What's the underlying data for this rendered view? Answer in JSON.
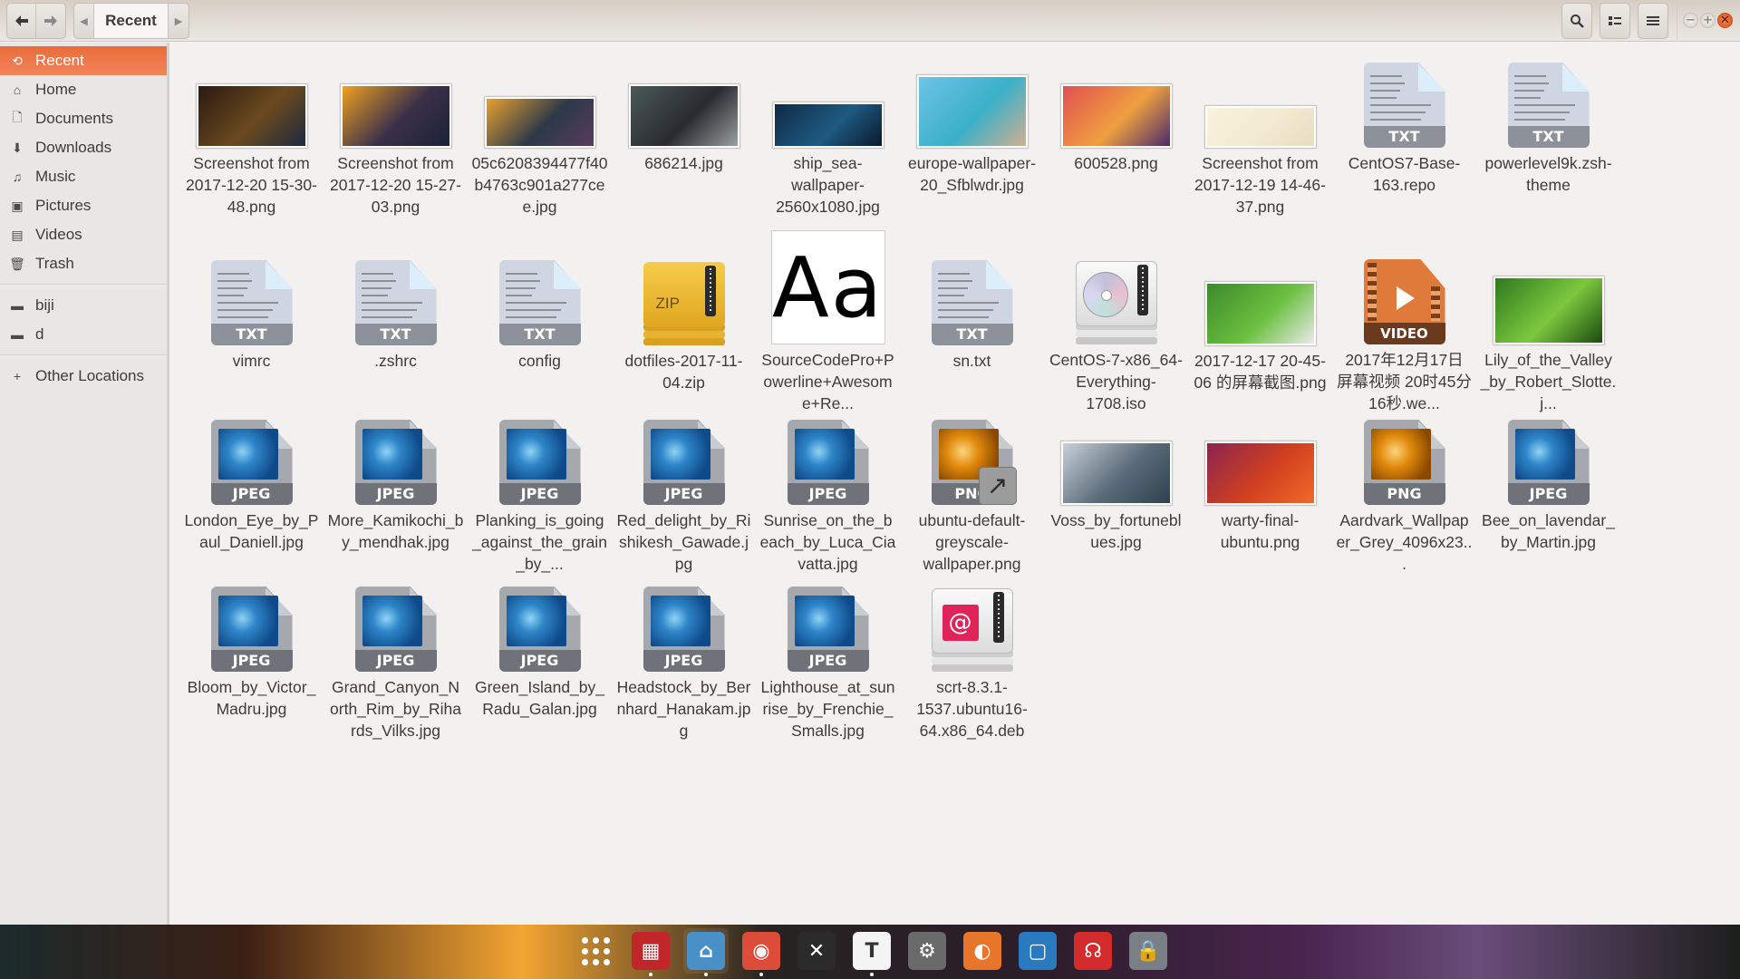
{
  "window": {
    "title": "Recent",
    "nav": {
      "back_icon": "arrow-left-icon",
      "forward_icon": "arrow-right-icon"
    },
    "path": {
      "current": "Recent",
      "left_arrow": "◀",
      "right_arrow": "▶"
    },
    "tools": {
      "search_icon": "search-icon",
      "view_icon": "list-view-icon",
      "menu_icon": "hamburger-menu-icon"
    },
    "controls": {
      "minimize": "−",
      "maximize": "+",
      "close": "✕"
    }
  },
  "sidebar": {
    "places": [
      {
        "label": "Recent",
        "icon": "recent-icon",
        "glyph": "⟲",
        "active": true
      },
      {
        "label": "Home",
        "icon": "home-icon",
        "glyph": "⌂"
      },
      {
        "label": "Documents",
        "icon": "documents-icon",
        "glyph": "🗋"
      },
      {
        "label": "Downloads",
        "icon": "downloads-icon",
        "glyph": "⬇"
      },
      {
        "label": "Music",
        "icon": "music-icon",
        "glyph": "♫"
      },
      {
        "label": "Pictures",
        "icon": "pictures-icon",
        "glyph": "▣"
      },
      {
        "label": "Videos",
        "icon": "videos-icon",
        "glyph": "▤"
      },
      {
        "label": "Trash",
        "icon": "trash-icon",
        "glyph": "🗑"
      }
    ],
    "bookmarks": [
      {
        "label": "biji",
        "icon": "folder-icon",
        "glyph": "▬"
      },
      {
        "label": "d",
        "icon": "folder-icon",
        "glyph": "▬"
      }
    ],
    "other": {
      "label": "Other Locations",
      "icon": "plus-icon",
      "glyph": "+"
    }
  },
  "files": [
    {
      "name": "Screenshot from 2017-12-20 15-30-48.png",
      "kind": "photo",
      "colors": [
        "#2a1a12",
        "#6b4a1e",
        "#1c2a40"
      ]
    },
    {
      "name": "Screenshot from 2017-12-20 15-27-03.png",
      "kind": "photo",
      "colors": [
        "#f0a020",
        "#3a3048",
        "#1a2238"
      ]
    },
    {
      "name": "05c6208394477f40b4763c901a277cee.jpg",
      "kind": "photo",
      "colors": [
        "#e8a030",
        "#2c3a48",
        "#5a3a60"
      ]
    },
    {
      "name": "686214.jpg",
      "kind": "photo",
      "colors": [
        "#4a5a58",
        "#2a2a30",
        "#9aa0a0"
      ]
    },
    {
      "name": "ship_sea-wallpaper-2560x1080.jpg",
      "kind": "photo",
      "colors": [
        "#0f2a44",
        "#1e5a82",
        "#0a1a2a"
      ]
    },
    {
      "name": "europe-wallpaper-20_Sfblwdr.jpg",
      "kind": "photo",
      "colors": [
        "#6ec4e6",
        "#3ab0c8",
        "#d0b090"
      ]
    },
    {
      "name": "600528.png",
      "kind": "photo",
      "colors": [
        "#e05050",
        "#f0a040",
        "#4a2a6a"
      ]
    },
    {
      "name": "Screenshot from 2017-12-19 14-46-37.png",
      "kind": "photo",
      "colors": [
        "#fbf2dc",
        "#f3ead2",
        "#e8dcc0"
      ]
    },
    {
      "name": "CentOS7-Base-163.repo",
      "kind": "txt",
      "badge": "TXT"
    },
    {
      "name": "powerlevel9k.zsh-theme",
      "kind": "txt",
      "badge": "TXT"
    },
    {
      "name": "vimrc",
      "kind": "txt",
      "badge": "TXT"
    },
    {
      "name": ".zshrc",
      "kind": "txt",
      "badge": "TXT"
    },
    {
      "name": "config",
      "kind": "txt",
      "badge": "TXT"
    },
    {
      "name": "dotfiles-2017-11-04.zip",
      "kind": "zip",
      "badge": "ZIP"
    },
    {
      "name": "SourceCodePro+Powerline+Awesome+Re...",
      "kind": "font",
      "preview": "Aa"
    },
    {
      "name": "sn.txt",
      "kind": "txt",
      "badge": "TXT"
    },
    {
      "name": "CentOS-7-x86_64-Everything-1708.iso",
      "kind": "iso"
    },
    {
      "name": "2017-12-17 20-45-06 的屏幕截图.png",
      "kind": "photo",
      "colors": [
        "#3a8a2a",
        "#6cc040",
        "#eaeaea"
      ]
    },
    {
      "name": "2017年12月17日 屏幕视频 20时45分16秒.we...",
      "kind": "video",
      "badge": "VIDEO"
    },
    {
      "name": "Lily_of_the_Valley_by_Robert_Slotte.j...",
      "kind": "photo",
      "colors": [
        "#2e7a1e",
        "#7cc83e",
        "#1a4a10"
      ]
    },
    {
      "name": "London_Eye_by_Paul_Daniell.jpg",
      "kind": "image-generic",
      "badge": "JPEG",
      "tone": "blue"
    },
    {
      "name": "More_Kamikochi_by_mendhak.jpg",
      "kind": "image-generic",
      "badge": "JPEG",
      "tone": "blue"
    },
    {
      "name": "Planking_is_going_against_the_grain_by_...",
      "kind": "image-generic",
      "badge": "JPEG",
      "tone": "blue"
    },
    {
      "name": "Red_delight_by_Rishikesh_Gawade.jpg",
      "kind": "image-generic",
      "badge": "JPEG",
      "tone": "blue"
    },
    {
      "name": "Sunrise_on_the_beach_by_Luca_Ciavatta.jpg",
      "kind": "image-generic",
      "badge": "JPEG",
      "tone": "blue"
    },
    {
      "name": "ubuntu-default-greyscale-wallpaper.png",
      "kind": "image-generic",
      "badge": "PNG",
      "tone": "orange",
      "shortcut": true
    },
    {
      "name": "Voss_by_fortuneblues.jpg",
      "kind": "photo",
      "colors": [
        "#c8d0d8",
        "#5a6a78",
        "#30404c"
      ]
    },
    {
      "name": "warty-final-ubuntu.png",
      "kind": "photo",
      "colors": [
        "#8a2450",
        "#d2401e",
        "#f06a2a"
      ]
    },
    {
      "name": "Aardvark_Wallpaper_Grey_4096x23...",
      "kind": "image-generic",
      "badge": "PNG",
      "tone": "orange"
    },
    {
      "name": "Bee_on_lavendar_by_Martin.jpg",
      "kind": "image-generic",
      "badge": "JPEG",
      "tone": "blue"
    },
    {
      "name": "Bloom_by_Victor_Madru.jpg",
      "kind": "image-generic",
      "badge": "JPEG",
      "tone": "blue"
    },
    {
      "name": "Grand_Canyon_North_Rim_by_Rihards_Vilks.jpg",
      "kind": "image-generic",
      "badge": "JPEG",
      "tone": "blue"
    },
    {
      "name": "Green_Island_by_Radu_Galan.jpg",
      "kind": "image-generic",
      "badge": "JPEG",
      "tone": "blue"
    },
    {
      "name": "Headstock_by_Bernhard_Hanakam.jpg",
      "kind": "image-generic",
      "badge": "JPEG",
      "tone": "blue"
    },
    {
      "name": "Lighthouse_at_sunrise_by_Frenchie_Smalls.jpg",
      "kind": "image-generic",
      "badge": "JPEG",
      "tone": "blue"
    },
    {
      "name": "scrt-8.3.1-1537.ubuntu16-64.x86_64.deb",
      "kind": "deb"
    }
  ],
  "dock": [
    {
      "name": "show-applications",
      "icon": "app-grid-icon",
      "running": false
    },
    {
      "name": "terminal-tiles",
      "icon": "terminal-icon",
      "color": "#c0262a",
      "glyph": "▦",
      "running": true
    },
    {
      "name": "files",
      "icon": "files-home-icon",
      "color": "#4a90c8",
      "glyph": "⌂",
      "running": true,
      "focused": true
    },
    {
      "name": "chrome",
      "icon": "chrome-icon",
      "color": "#dd4b39",
      "glyph": "◉",
      "running": true
    },
    {
      "name": "sublime-text",
      "icon": "sublime-icon",
      "color": "#2b2b2b",
      "glyph": "✕",
      "running": false
    },
    {
      "name": "typora",
      "icon": "typora-icon",
      "color": "#f4f4f4",
      "glyph": "T",
      "running": true
    },
    {
      "name": "settings",
      "icon": "system-settings-icon",
      "color": "#6a6a6a",
      "glyph": "⚙",
      "running": false
    },
    {
      "name": "firefox",
      "icon": "firefox-icon",
      "color": "#e8762a",
      "glyph": "◐",
      "running": false
    },
    {
      "name": "virtualbox",
      "icon": "virtualbox-icon",
      "color": "#2a7ac0",
      "glyph": "▢",
      "running": false
    },
    {
      "name": "netease-music",
      "icon": "netease-music-icon",
      "color": "#d42c2c",
      "glyph": "☊",
      "running": false
    },
    {
      "name": "screen-lock",
      "icon": "screen-lock-icon",
      "color": "#7a7f86",
      "glyph": "🔒",
      "running": false
    }
  ]
}
